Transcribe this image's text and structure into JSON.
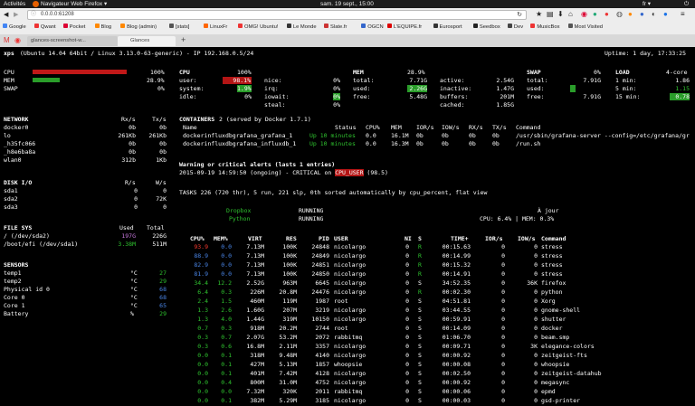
{
  "os": {
    "activities": "Activités",
    "app_menu": "Navigateur Web Firefox ▾",
    "clock": "sam. 19 sept., 15:00",
    "lang": "fr ▾"
  },
  "browser": {
    "url": "0.0.0.0:61208",
    "bookmarks": [
      "Google",
      "Qwant",
      "Pocket",
      "Blog",
      "Blog (admin)",
      "[stats]",
      "LinuxFr",
      "OMG! Ubuntu!",
      "Le Monde",
      "Slate.fr",
      "OGCN",
      "L'EQUIPE.fr",
      "Eurosport",
      "Seedbox",
      "Dev",
      "MusicBox",
      "Most Visited"
    ],
    "tabs": [
      {
        "label": "glances-screenshot-w..."
      },
      {
        "label": "Glances"
      }
    ],
    "new_tab": "+"
  },
  "header": {
    "host": "xps",
    "system": "(Ubuntu 14.04 64bit / Linux 3.13.0-63-generic) - IP 192.168.0.5/24",
    "uptime": "Uptime: 1 day, 17:33:25"
  },
  "quicklook": {
    "cpu_label": "CPU",
    "cpu_val": "100%",
    "cpu_frac": 1.0,
    "mem_label": "MEM",
    "mem_val": "28.9%",
    "mem_frac": 0.289,
    "swap_label": "SWAP",
    "swap_val": "0%",
    "swap_frac": 0
  },
  "cpu": {
    "title": "CPU",
    "total": "100%",
    "rows": [
      {
        "k": "user:",
        "v": "98.1%",
        "k2": "nice:",
        "v2": "0%"
      },
      {
        "k": "system:",
        "v": "1.9%",
        "k2": "irq:",
        "v2": "0%"
      },
      {
        "k": "idle:",
        "v": "0%",
        "k2": "iowait:",
        "v2": "0%"
      },
      {
        "k": "",
        "v": "",
        "k2": "steal:",
        "v2": "0%"
      }
    ]
  },
  "mem": {
    "title": "MEM",
    "pct": "28.9%",
    "rows": [
      {
        "k": "total:",
        "v": "7.71G",
        "k2": "active:",
        "v2": "2.54G"
      },
      {
        "k": "used:",
        "v": "2.26G",
        "k2": "inactive:",
        "v2": "1.47G"
      },
      {
        "k": "free:",
        "v": "5.48G",
        "k2": "buffers:",
        "v2": "201M"
      },
      {
        "k": "",
        "v": "",
        "k2": "cached:",
        "v2": "1.85G"
      }
    ]
  },
  "swap": {
    "title": "SWAP",
    "pct": "0%",
    "rows": [
      {
        "k": "total:",
        "v": "7.91G"
      },
      {
        "k": "used:",
        "v": "0"
      },
      {
        "k": "free:",
        "v": "7.91G"
      }
    ]
  },
  "load": {
    "title": "LOAD",
    "cores": "4-core",
    "rows": [
      {
        "k": "1 min:",
        "v": "1.86"
      },
      {
        "k": "5 min:",
        "v": "1.15"
      },
      {
        "k": "15 min:",
        "v": "0.78"
      }
    ]
  },
  "network": {
    "title": "NETWORK",
    "rx": "Rx/s",
    "tx": "Tx/s",
    "rows": [
      {
        "n": "docker0",
        "rx": "0b",
        "tx": "0b"
      },
      {
        "n": "lo",
        "rx": "261Kb",
        "tx": "261Kb"
      },
      {
        "n": "_h35fc066",
        "rx": "0b",
        "tx": "0b"
      },
      {
        "n": "_h8e6ba8a",
        "rx": "0b",
        "tx": "0b"
      },
      {
        "n": "wlan0",
        "rx": "312b",
        "tx": "1Kb"
      }
    ]
  },
  "disk": {
    "title": "DISK I/O",
    "r": "R/s",
    "w": "W/s",
    "rows": [
      {
        "n": "sda1",
        "r": "0",
        "w": "0"
      },
      {
        "n": "sda2",
        "r": "0",
        "w": "72K"
      },
      {
        "n": "sda3",
        "r": "0",
        "w": "0"
      }
    ]
  },
  "fs": {
    "title": "FILE SYS",
    "used": "Used",
    "total": "Total",
    "rows": [
      {
        "n": "/ (/dev/sda2)",
        "u": "197G",
        "t": "226G"
      },
      {
        "n": "/boot/efi (/dev/sda1)",
        "u": "3.38M",
        "t": "511M"
      }
    ]
  },
  "sensors": {
    "title": "SENSORS",
    "rows": [
      {
        "n": "temp1",
        "unit": "°C",
        "v": "27"
      },
      {
        "n": "temp2",
        "unit": "°C",
        "v": "29"
      },
      {
        "n": "Physical id 0",
        "unit": "°C",
        "v": "68"
      },
      {
        "n": "Core 0",
        "unit": "°C",
        "v": "68"
      },
      {
        "n": "Core 1",
        "unit": "°C",
        "v": "65"
      },
      {
        "n": "Battery",
        "unit": "%",
        "v": "29"
      }
    ]
  },
  "containers": {
    "title": "CONTAINERS",
    "subtitle": "2 (served by Docker 1.7.1)",
    "headers": [
      "Name",
      "Status",
      "CPU%",
      "MEM",
      "IOR/s",
      "IOW/s",
      "RX/s",
      "TX/s",
      "Command"
    ],
    "rows": [
      {
        "name": "dockerinfluxdbgrafana_grafana_1",
        "status": "Up 10 minutes",
        "cpu": "0.0",
        "mem": "16.1M",
        "ior": "0b",
        "iow": "0b",
        "rx": "0b",
        "tx": "0b",
        "cmd": "/usr/sbin/grafana-server --config=/etc/grafana/gr"
      },
      {
        "name": "dockerinfluxdbgrafana_influxdb_1",
        "status": "Up 10 minutes",
        "cpu": "0.0",
        "mem": "16.3M",
        "ior": "0b",
        "iow": "0b",
        "rx": "0b",
        "tx": "0b",
        "cmd": "/run.sh"
      }
    ]
  },
  "alerts": {
    "title": "Warning or critical alerts (lasts 1 entries)",
    "line_pre": "2015-09-19 14:59:50 (ongoing) - CRITICAL on ",
    "line_key": "CPU_USER",
    "line_post": " (98.5)"
  },
  "tasks": {
    "summary": "TASKS 226 (720 thr), 5 run, 221 slp, 0th sorted automatically by cpu_percent, flat view",
    "left": [
      {
        "n": "Dropbox",
        "s": "RUNNING"
      },
      {
        "n": "Python",
        "s": "RUNNING"
      }
    ],
    "right1": "À jour",
    "right2": "CPU: 6.4% | MEM: 0.3%"
  },
  "processes": {
    "headers": [
      "CPU%",
      "MEM%",
      "VIRT",
      "RES",
      "PID",
      "USER",
      "NI",
      "S",
      "TIME+",
      "IOR/s",
      "IOW/s",
      "Command"
    ],
    "rows": [
      {
        "cpu": "93.9",
        "mem": "0.0",
        "virt": "7.13M",
        "res": "100K",
        "pid": "24848",
        "user": "nicolargo",
        "ni": "0",
        "s": "R",
        "time": "00:15.63",
        "ior": "0",
        "iow": "0",
        "cmd": "stress",
        "cc": "r",
        "mc": "c"
      },
      {
        "cpu": "88.9",
        "mem": "0.0",
        "virt": "7.13M",
        "res": "100K",
        "pid": "24849",
        "user": "nicolargo",
        "ni": "0",
        "s": "R",
        "time": "00:14.99",
        "ior": "0",
        "iow": "0",
        "cmd": "stress",
        "cc": "c",
        "mc": "c"
      },
      {
        "cpu": "82.9",
        "mem": "0.0",
        "virt": "7.13M",
        "res": "100K",
        "pid": "24851",
        "user": "nicolargo",
        "ni": "0",
        "s": "R",
        "time": "00:15.32",
        "ior": "0",
        "iow": "0",
        "cmd": "stress",
        "cc": "c",
        "mc": "c"
      },
      {
        "cpu": "81.9",
        "mem": "0.0",
        "virt": "7.13M",
        "res": "100K",
        "pid": "24850",
        "user": "nicolargo",
        "ni": "0",
        "s": "R",
        "time": "00:14.91",
        "ior": "0",
        "iow": "0",
        "cmd": "stress",
        "cc": "c",
        "mc": "c"
      },
      {
        "cpu": "34.4",
        "mem": "12.2",
        "virt": "2.52G",
        "res": "963M",
        "pid": "6645",
        "user": "nicolargo",
        "ni": "0",
        "s": "S",
        "time": "34:52.35",
        "ior": "0",
        "iow": "36K",
        "cmd": "firefox",
        "cc": "g",
        "mc": "g"
      },
      {
        "cpu": "6.4",
        "mem": "0.3",
        "virt": "226M",
        "res": "20.8M",
        "pid": "24476",
        "user": "nicolargo",
        "ni": "0",
        "s": "R",
        "time": "00:02.30",
        "ior": "0",
        "iow": "0",
        "cmd": "python",
        "cc": "g",
        "mc": "g"
      },
      {
        "cpu": "2.4",
        "mem": "1.5",
        "virt": "460M",
        "res": "119M",
        "pid": "1987",
        "user": "root",
        "ni": "0",
        "s": "S",
        "time": "04:51.81",
        "ior": "0",
        "iow": "0",
        "cmd": "Xorg",
        "cc": "g",
        "mc": "g"
      },
      {
        "cpu": "1.3",
        "mem": "2.6",
        "virt": "1.60G",
        "res": "207M",
        "pid": "3219",
        "user": "nicolargo",
        "ni": "0",
        "s": "S",
        "time": "03:44.55",
        "ior": "0",
        "iow": "0",
        "cmd": "gnome-shell",
        "cc": "g",
        "mc": "g"
      },
      {
        "cpu": "1.3",
        "mem": "4.0",
        "virt": "1.44G",
        "res": "319M",
        "pid": "10150",
        "user": "nicolargo",
        "ni": "0",
        "s": "S",
        "time": "00:59.91",
        "ior": "0",
        "iow": "0",
        "cmd": "shutter",
        "cc": "g",
        "mc": "g"
      },
      {
        "cpu": "0.7",
        "mem": "0.3",
        "virt": "918M",
        "res": "20.2M",
        "pid": "2744",
        "user": "root",
        "ni": "0",
        "s": "S",
        "time": "00:14.09",
        "ior": "0",
        "iow": "0",
        "cmd": "docker",
        "cc": "g",
        "mc": "g"
      },
      {
        "cpu": "0.3",
        "mem": "0.7",
        "virt": "2.07G",
        "res": "53.2M",
        "pid": "2072",
        "user": "rabbitmq",
        "ni": "0",
        "s": "S",
        "time": "01:06.70",
        "ior": "0",
        "iow": "0",
        "cmd": "beam.smp",
        "cc": "g",
        "mc": "g"
      },
      {
        "cpu": "0.3",
        "mem": "0.6",
        "virt": "16.8M",
        "res": "2.11M",
        "pid": "3357",
        "user": "nicolargo",
        "ni": "0",
        "s": "S",
        "time": "00:09.71",
        "ior": "0",
        "iow": "3K",
        "cmd": "elegance-colors",
        "cc": "g",
        "mc": "g"
      },
      {
        "cpu": "0.0",
        "mem": "0.1",
        "virt": "318M",
        "res": "9.48M",
        "pid": "4140",
        "user": "nicolargo",
        "ni": "0",
        "s": "S",
        "time": "00:00.92",
        "ior": "0",
        "iow": "0",
        "cmd": "zeitgeist-fts",
        "cc": "g",
        "mc": "g"
      },
      {
        "cpu": "0.0",
        "mem": "0.1",
        "virt": "427M",
        "res": "5.13M",
        "pid": "1857",
        "user": "whoopsie",
        "ni": "0",
        "s": "S",
        "time": "00:00.08",
        "ior": "0",
        "iow": "0",
        "cmd": "whoopsie",
        "cc": "g",
        "mc": "g"
      },
      {
        "cpu": "0.0",
        "mem": "0.1",
        "virt": "401M",
        "res": "7.42M",
        "pid": "4128",
        "user": "nicolargo",
        "ni": "0",
        "s": "S",
        "time": "00:02.50",
        "ior": "0",
        "iow": "0",
        "cmd": "zeitgeist-datahub",
        "cc": "g",
        "mc": "g"
      },
      {
        "cpu": "0.0",
        "mem": "0.4",
        "virt": "800M",
        "res": "31.0M",
        "pid": "4752",
        "user": "nicolargo",
        "ni": "0",
        "s": "S",
        "time": "00:00.92",
        "ior": "0",
        "iow": "0",
        "cmd": "megasync",
        "cc": "g",
        "mc": "g"
      },
      {
        "cpu": "0.0",
        "mem": "0.0",
        "virt": "7.32M",
        "res": "320K",
        "pid": "2011",
        "user": "rabbitmq",
        "ni": "0",
        "s": "S",
        "time": "00:00.06",
        "ior": "0",
        "iow": "0",
        "cmd": "epmd",
        "cc": "g",
        "mc": "g"
      },
      {
        "cpu": "0.0",
        "mem": "0.1",
        "virt": "382M",
        "res": "5.29M",
        "pid": "3185",
        "user": "nicolargo",
        "ni": "0",
        "s": "S",
        "time": "00:00.03",
        "ior": "0",
        "iow": "0",
        "cmd": "gsd-printer",
        "cc": "g",
        "mc": "g"
      }
    ]
  },
  "colors": {
    "ok": "#2fc42f",
    "careful": "#4aa3ff",
    "critical": "#ff3b30",
    "crit_bg": "#b31515",
    "ok_bg": "#2a9d2a"
  }
}
